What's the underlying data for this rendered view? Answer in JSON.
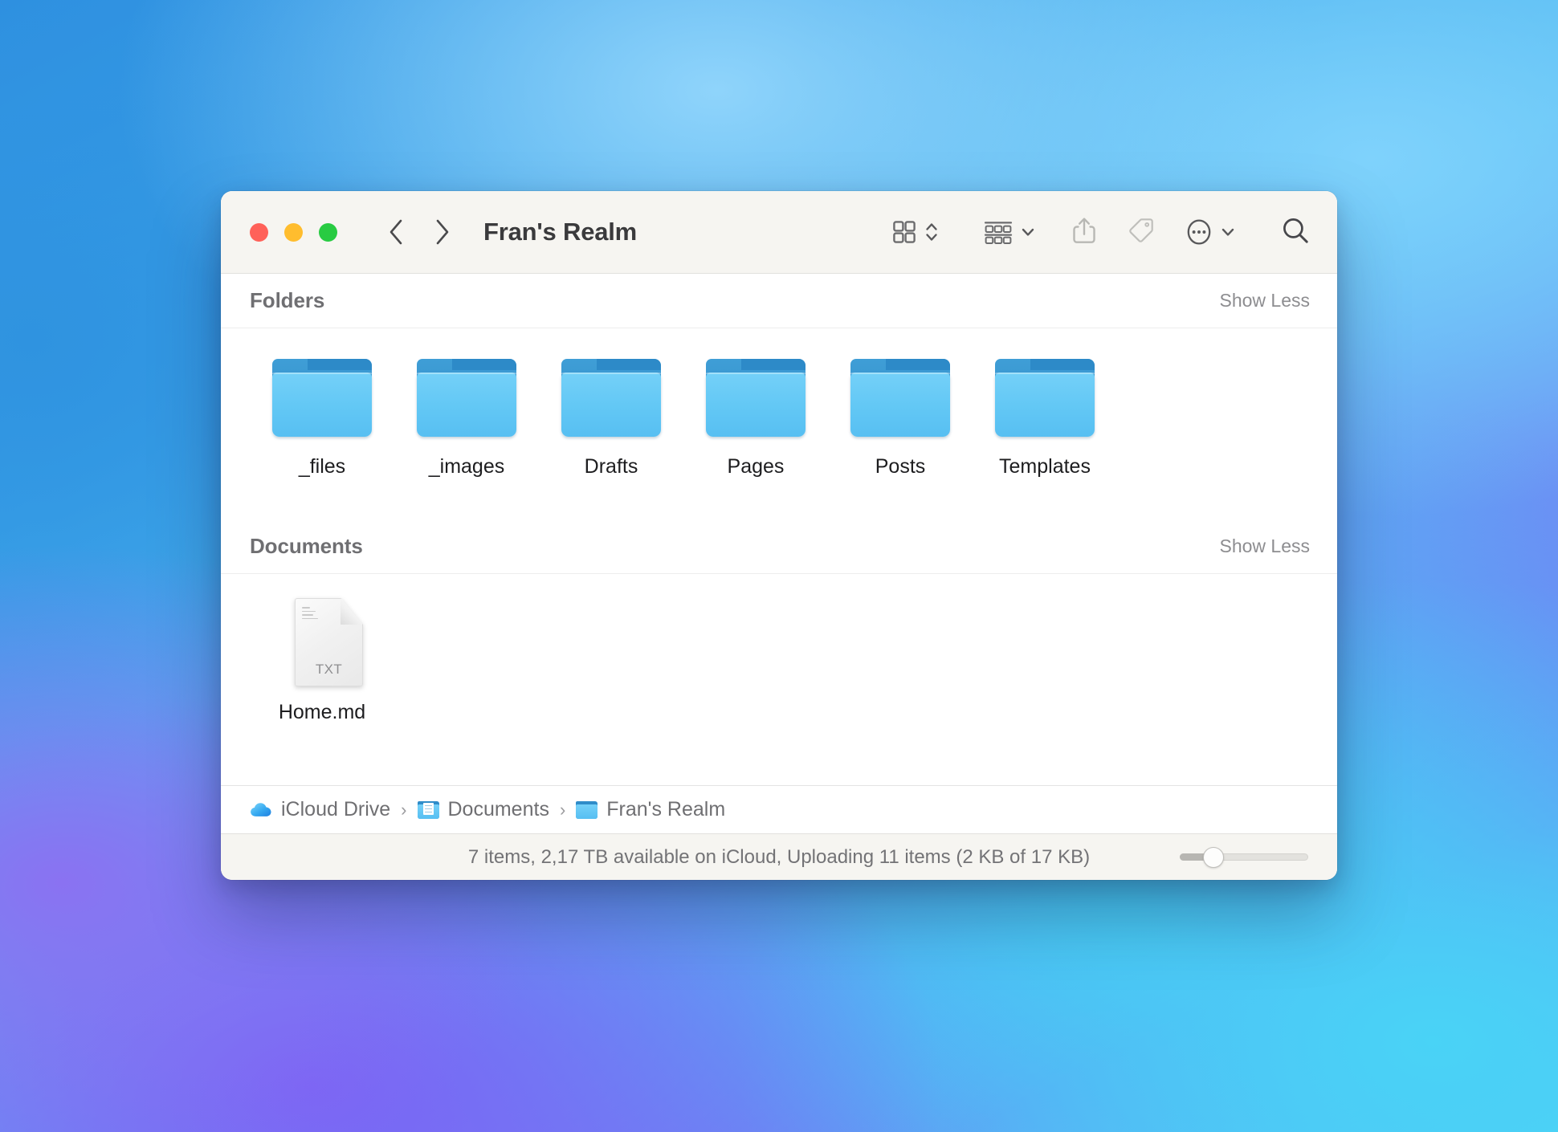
{
  "window": {
    "title": "Fran's Realm",
    "traffic_lights": [
      {
        "name": "close",
        "color": "#ff6159"
      },
      {
        "name": "minimize",
        "color": "#ffbd2e"
      },
      {
        "name": "maximize",
        "color": "#28cb42"
      }
    ],
    "nav": {
      "back_icon": "chevron-left-icon",
      "forward_icon": "chevron-right-icon"
    },
    "toolbar_items": [
      {
        "name": "view-mode-icon",
        "icon": "grid-view-icon"
      },
      {
        "name": "group-by-icon",
        "icon": "group-rows-icon"
      },
      {
        "name": "share-icon",
        "icon": "share-upload-icon"
      },
      {
        "name": "tags-icon",
        "icon": "tag-icon"
      },
      {
        "name": "more-icon",
        "icon": "ellipsis-circle-icon"
      },
      {
        "name": "search-icon",
        "icon": "magnifier-icon"
      }
    ]
  },
  "sections": [
    {
      "title": "Folders",
      "toggle_label": "Show Less",
      "items": [
        {
          "label": "_files",
          "kind": "folder"
        },
        {
          "label": "_images",
          "kind": "folder"
        },
        {
          "label": "Drafts",
          "kind": "folder"
        },
        {
          "label": "Pages",
          "kind": "folder"
        },
        {
          "label": "Posts",
          "kind": "folder"
        },
        {
          "label": "Templates",
          "kind": "folder"
        }
      ]
    },
    {
      "title": "Documents",
      "toggle_label": "Show Less",
      "items": [
        {
          "label": "Home.md",
          "kind": "document",
          "extension": "TXT"
        }
      ]
    }
  ],
  "breadcrumb": [
    {
      "label": "iCloud Drive",
      "icon": "icloud-cloud-icon"
    },
    {
      "label": "Documents",
      "icon": "documents-folder-icon"
    },
    {
      "label": "Fran's Realm",
      "icon": "folder-icon"
    }
  ],
  "breadcrumb_separator": "›",
  "status": {
    "text": "7 items, 2,17 TB available on iCloud, Uploading 11 items (2 KB of 17 KB)",
    "zoom_slider_value": 26
  },
  "colors": {
    "toolbar_bg": "#f6f5f1",
    "content_bg": "#ffffff",
    "folder_front": "#63c8f5",
    "folder_back": "#2f8cc9",
    "accent_text": "#6f6f72"
  }
}
